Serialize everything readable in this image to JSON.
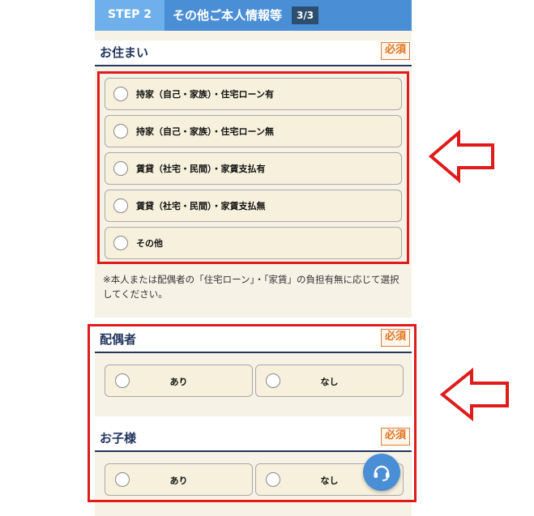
{
  "header": {
    "step_label": "STEP 2",
    "title": "その他ご本人情報等",
    "progress": "3/3"
  },
  "residence": {
    "title": "お住まい",
    "required": "必須",
    "options": [
      "持家（自己・家族）・住宅ローン有",
      "持家（自己・家族）・住宅ローン無",
      "賃貸（社宅・民間）・家賃支払有",
      "賃貸（社宅・民間）・家賃支払無",
      "その他"
    ],
    "note": "※本人または配偶者の「住宅ローン」・「家賃」の負担有無に応じて選択してください。"
  },
  "spouse": {
    "title": "配偶者",
    "required": "必須",
    "options": [
      "あり",
      "なし"
    ]
  },
  "children": {
    "title": "お子様",
    "required": "必須",
    "options": [
      "あり",
      "なし"
    ]
  },
  "colors": {
    "header_blue": "#4a8fd6",
    "highlight_red": "#e01b1b",
    "navy": "#23365f",
    "required_orange": "#e07320"
  },
  "icons": {
    "support": "headset-icon",
    "annotation": "left-arrow-icon"
  }
}
